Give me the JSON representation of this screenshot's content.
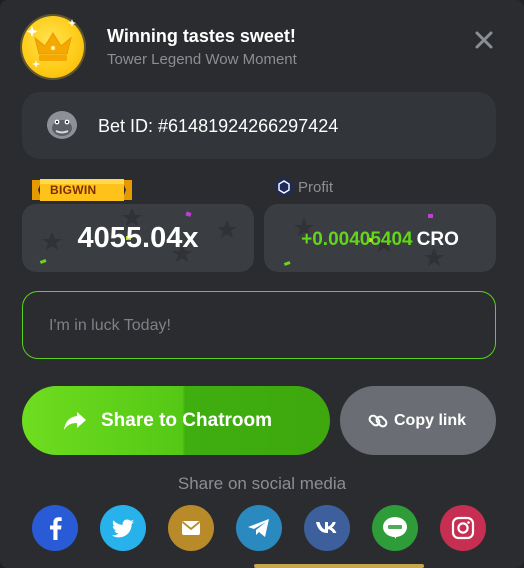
{
  "header": {
    "title": "Winning tastes sweet!",
    "subtitle": "Tower Legend Wow Moment",
    "close_icon": "close-icon",
    "trophy_icon": "crown-icon"
  },
  "bet": {
    "label": "Bet ID: #61481924266297424",
    "avatar_icon": "gorilla-avatar-icon"
  },
  "win": {
    "badge": "BIGWIN",
    "multiplier": "4055.04x",
    "profit_label": "Profit",
    "profit_value": "+0.00405404",
    "currency": "CRO",
    "currency_icon": "cronos-icon"
  },
  "message": {
    "text": "I'm in luck Today!"
  },
  "actions": {
    "share_label": "Share to Chatroom",
    "copy_label": "Copy link"
  },
  "social": {
    "title": "Share on social media",
    "items": [
      {
        "name": "facebook",
        "icon": "facebook-icon",
        "color": "#2a5bd7"
      },
      {
        "name": "twitter",
        "icon": "twitter-icon",
        "color": "#27b2ec"
      },
      {
        "name": "email",
        "icon": "mail-icon",
        "color": "#b88a2a"
      },
      {
        "name": "telegram",
        "icon": "telegram-icon",
        "color": "#2a8ac0"
      },
      {
        "name": "vk",
        "icon": "vk-icon",
        "color": "#3d5f9c"
      },
      {
        "name": "line",
        "icon": "line-icon",
        "color": "#2f9c3a"
      },
      {
        "name": "instagram",
        "icon": "instagram-icon",
        "color": "#c62e52"
      }
    ]
  },
  "colors": {
    "accent_green": "#5ad11a",
    "profit_green": "#62d618",
    "panel": "#2a2c2f"
  }
}
